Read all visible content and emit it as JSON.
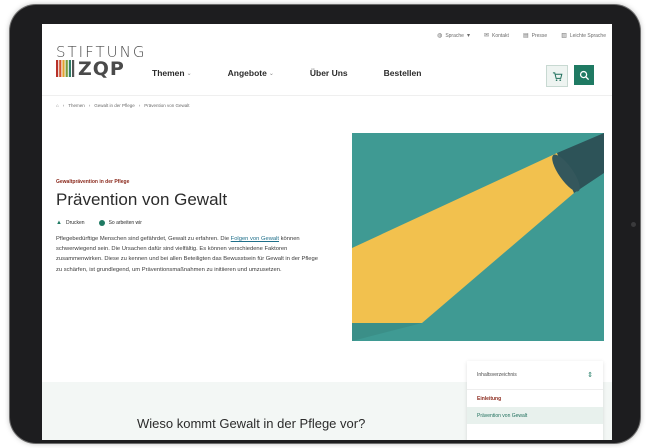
{
  "utility": {
    "language": "Sprache",
    "contact": "Kontakt",
    "press": "Presse",
    "easy_language": "Leichte Sprache"
  },
  "logo": {
    "top": "STIFTUNG",
    "word": "ZQP"
  },
  "nav": {
    "items": [
      {
        "label": "Themen",
        "has_dropdown": true
      },
      {
        "label": "Angebote",
        "has_dropdown": true
      },
      {
        "label": "Über Uns",
        "has_dropdown": false
      },
      {
        "label": "Bestellen",
        "has_dropdown": false
      }
    ]
  },
  "header_icons": {
    "cart": "cart-icon",
    "search": "search-icon"
  },
  "breadcrumb": {
    "items": [
      "Themen",
      "Gewalt in der Pflege",
      "Prävention von Gewalt"
    ]
  },
  "article": {
    "kicker": "Gewaltprävention in der Pflege",
    "title": "Prävention von Gewalt",
    "actions": {
      "print": "Drucken",
      "how_we_work": "So arbeiten wir"
    },
    "lead_1": "Pflegebedürftige Menschen sind gefährdet, Gewalt zu erfahren. Die",
    "lead_link": "Folgen von Gewalt",
    "lead_2": "können schwerwiegend sein. Die Ursachen dafür sind vielfältig. Es können verschiedene Faktoren zusammenwirken. Diese zu kennen und bei allen Beteiligten das Bewusstsein für Gewalt in der Pflege zu schärfen, ist grundlegend, um Präventionsmaßnahmen zu initiieren und umzusetzen."
  },
  "toc": {
    "heading": "Inhaltsverzeichnis",
    "items": [
      "Einleitung",
      "Prävention von Gewalt"
    ]
  },
  "section": {
    "heading": "Wieso kommt Gewalt in der Pflege vor?"
  },
  "colors": {
    "brand_green": "#1f7a63",
    "kicker_red": "#8b2a1d",
    "illustration_teal": "#3f9a93",
    "light_beam": "#f2c14e"
  }
}
